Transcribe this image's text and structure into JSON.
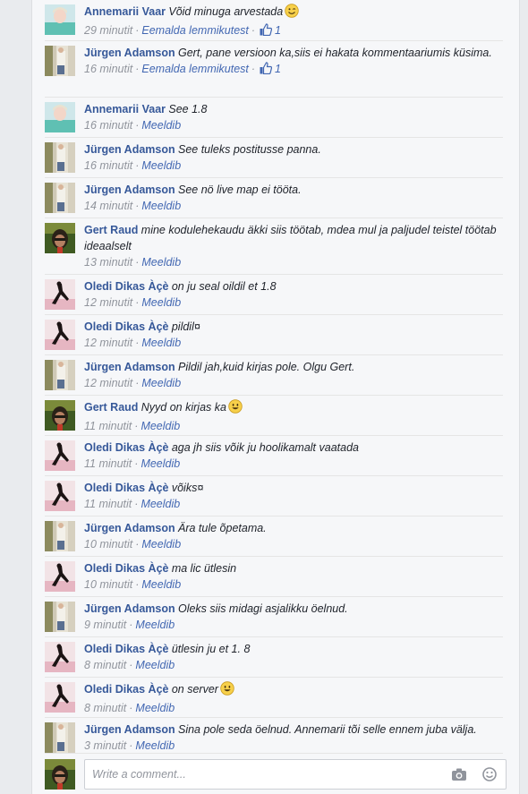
{
  "comments": [
    {
      "avatar": "annemarii",
      "author": "Annemarii Vaar",
      "text": "Võid minuga arvestada",
      "emoji": "wink",
      "time": "29 minutit",
      "action": "Eemalda lemmikutest",
      "likes": "1"
    },
    {
      "avatar": "jurgen",
      "author": "Jürgen Adamson",
      "text": "Gert, pane versioon ka,siis ei hakata kommentaariumis küsima.",
      "time": "16 minutit",
      "action": "Eemalda lemmikutest",
      "likes": "1"
    },
    {
      "avatar": "annemarii",
      "author": "Annemarii Vaar",
      "text": "See 1.8",
      "time": "16 minutit",
      "action": "Meeldib"
    },
    {
      "avatar": "jurgen",
      "author": "Jürgen Adamson",
      "text": "See tuleks postitusse panna.",
      "time": "16 minutit",
      "action": "Meeldib"
    },
    {
      "avatar": "jurgen",
      "author": "Jürgen Adamson",
      "text": "See nö live map ei tööta.",
      "time": "14 minutit",
      "action": "Meeldib"
    },
    {
      "avatar": "gert",
      "author": "Gert Raud",
      "text": "mine kodulehekaudu äkki siis töötab, mdea mul ja paljudel teistel töötab ideaalselt",
      "time": "13 minutit",
      "action": "Meeldib"
    },
    {
      "avatar": "oledi",
      "author": "Oledi Dikas Àçè",
      "text": "on ju seal oildil et 1.8",
      "time": "12 minutit",
      "action": "Meeldib"
    },
    {
      "avatar": "oledi",
      "author": "Oledi Dikas Àçè",
      "text": "pildil¤",
      "time": "12 minutit",
      "action": "Meeldib"
    },
    {
      "avatar": "jurgen",
      "author": "Jürgen Adamson",
      "text": "Pildil jah,kuid kirjas pole. Olgu Gert.",
      "time": "12 minutit",
      "action": "Meeldib"
    },
    {
      "avatar": "gert",
      "author": "Gert Raud",
      "text": "Nyyd on kirjas ka",
      "emoji": "smile",
      "time": "11 minutit",
      "action": "Meeldib"
    },
    {
      "avatar": "oledi",
      "author": "Oledi Dikas Àçè",
      "text": "aga jh siis võik ju hoolikamalt vaatada",
      "time": "11 minutit",
      "action": "Meeldib"
    },
    {
      "avatar": "oledi",
      "author": "Oledi Dikas Àçè",
      "text": "võiks¤",
      "time": "11 minutit",
      "action": "Meeldib"
    },
    {
      "avatar": "jurgen",
      "author": "Jürgen Adamson",
      "text": "Ära tule õpetama.",
      "time": "10 minutit",
      "action": "Meeldib"
    },
    {
      "avatar": "oledi",
      "author": "Oledi Dikas Àçè",
      "text": "ma lic ütlesin",
      "time": "10 minutit",
      "action": "Meeldib"
    },
    {
      "avatar": "jurgen",
      "author": "Jürgen Adamson",
      "text": "Oleks siis midagi asjalikku öelnud.",
      "time": "9 minutit",
      "action": "Meeldib"
    },
    {
      "avatar": "oledi",
      "author": "Oledi Dikas Àçè",
      "text": "ütlesin ju et 1. 8",
      "time": "8 minutit",
      "action": "Meeldib"
    },
    {
      "avatar": "oledi",
      "author": "Oledi Dikas Àçè",
      "text": "on server",
      "emoji": "smile",
      "time": "8 minutit",
      "action": "Meeldib"
    },
    {
      "avatar": "jurgen",
      "author": "Jürgen Adamson",
      "text": "Sina pole seda öelnud. Annemarii tõi selle ennem juba välja.",
      "time": "3 minutit",
      "action": "Meeldib"
    }
  ],
  "compose": {
    "placeholder": "Write a comment...",
    "avatar": "gert",
    "camera_icon": "camera-icon",
    "emoji_icon": "emoji-icon"
  },
  "colors": {
    "author": "#365899",
    "link": "#4267b2",
    "meta": "#90949c",
    "panel_bg": "#f6f7f9"
  }
}
